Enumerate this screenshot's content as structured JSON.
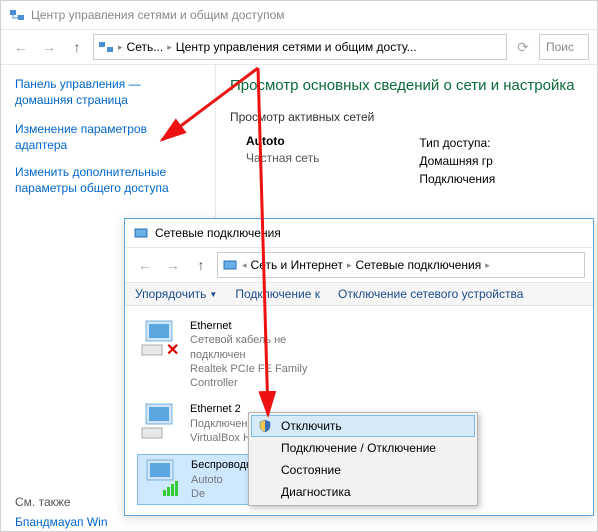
{
  "window1": {
    "title": "Центр управления сетями и общим доступом",
    "breadcrumb": {
      "root": "Сеть...",
      "current": "Центр управления сетями и общим досту..."
    },
    "search_placeholder": "Поис",
    "sidebar": {
      "home": "Панель управления — домашняя страница",
      "link_adapter": "Изменение параметров адаптера",
      "link_sharing": "Изменить дополнительные параметры общего доступа"
    },
    "main": {
      "heading": "Просмотр основных сведений о сети и настройка",
      "active_nets": "Просмотр активных сетей",
      "net_name": "Autoto",
      "net_type": "Частная сеть",
      "access_label": "Тип доступа:",
      "home_label": "Домашняя гр",
      "conn_label": "Подключения"
    },
    "footer": {
      "also": "См. также",
      "firewall": "Бпандмауап Win"
    }
  },
  "window2": {
    "title": "Сетевые подключения",
    "breadcrumb": {
      "net": "Сеть и Интернет",
      "conn": "Сетевые подключения"
    },
    "toolbar": {
      "organize": "Упорядочить",
      "connect": "Подключение к",
      "disable": "Отключение сетевого устройства"
    },
    "connections": [
      {
        "name": "Ethernet",
        "status": "Сетевой кабель не подключен",
        "driver": "Realtek PCIe FE Family Controller",
        "disabled": true
      },
      {
        "name": "Ethernet 2",
        "status": "Подключено",
        "driver": "VirtualBox Host-Only Eth",
        "disabled": false
      },
      {
        "name": "Беспроводная сеть",
        "status": "Autoto",
        "driver": "De",
        "selected": true
      }
    ]
  },
  "context_menu": {
    "disable": "Отключить",
    "toggle": "Подключение / Отключение",
    "status": "Состояние",
    "diag": "Диагностика"
  }
}
